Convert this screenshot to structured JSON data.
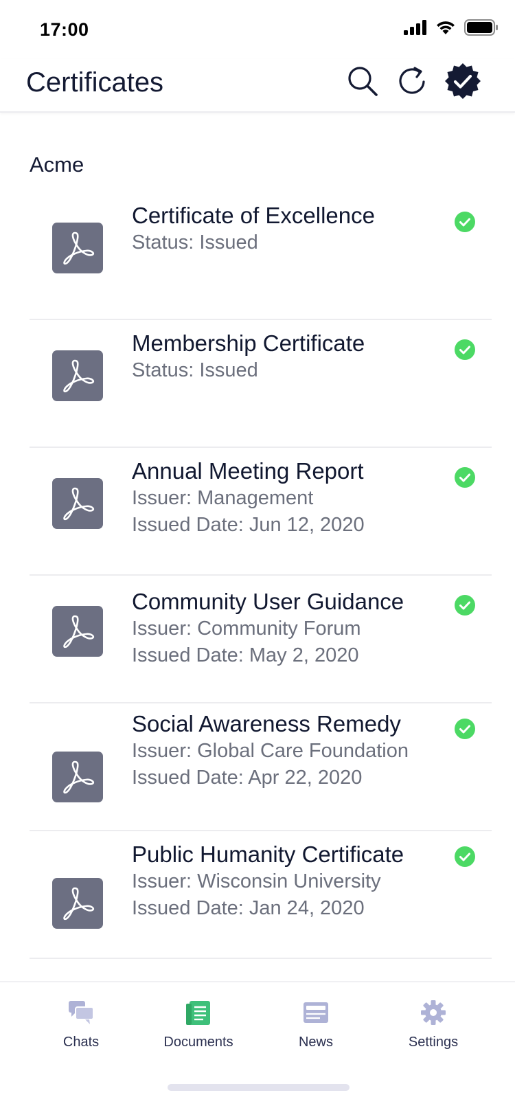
{
  "status_bar": {
    "time": "17:00"
  },
  "header": {
    "title": "Certificates",
    "actions": [
      "search-icon",
      "refresh-icon",
      "verified-badge-icon"
    ]
  },
  "section": {
    "title": "Acme"
  },
  "documents": [
    {
      "title": "Certificate of Excellence",
      "lines": [
        "Status: Issued"
      ]
    },
    {
      "title": "Membership Certificate",
      "lines": [
        "Status: Issued"
      ]
    },
    {
      "title": "Annual Meeting Report",
      "lines": [
        "Issuer: Management",
        "Issued Date: Jun 12, 2020"
      ]
    },
    {
      "title": "Community User Guidance",
      "lines": [
        "Issuer: Community Forum",
        "Issued Date: May 2, 2020"
      ]
    },
    {
      "title": "Social Awareness Remedy",
      "lines": [
        "Issuer: Global Care Foundation",
        "Issued Date: Apr 22, 2020"
      ]
    },
    {
      "title": "Public Humanity Certificate",
      "lines": [
        "Issuer: Wisconsin University",
        "Issued Date: Jan 24, 2020"
      ]
    }
  ],
  "tabs": [
    {
      "label": "Chats",
      "icon": "chat-bubbles-icon"
    },
    {
      "label": "Documents",
      "icon": "documents-icon",
      "active": true
    },
    {
      "label": "News",
      "icon": "news-icon"
    },
    {
      "label": "Settings",
      "icon": "gear-icon"
    }
  ],
  "colors": {
    "primary_text": "#141a33",
    "secondary_text": "#6b6f7c",
    "pdf_tile": "#6c6f82",
    "check_green": "#4cd964",
    "tab_active": "#3ec07a",
    "tab_inactive": "#aeb2d6"
  }
}
